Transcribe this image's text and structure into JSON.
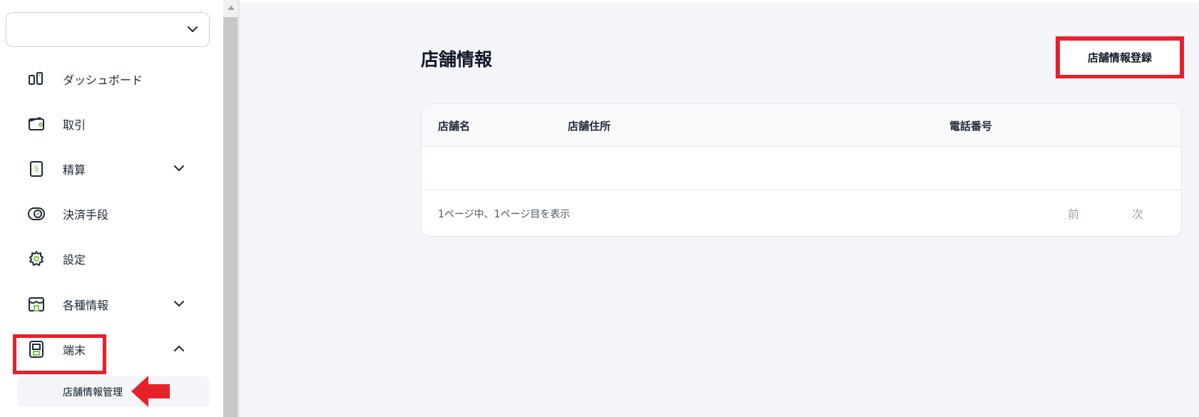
{
  "sidebar": {
    "select_value": "",
    "items": [
      {
        "label": "ダッシュボード",
        "icon": "dashboard-icon",
        "expandable": false
      },
      {
        "label": "取引",
        "icon": "wallet-icon",
        "expandable": false
      },
      {
        "label": "精算",
        "icon": "dollar-receipt-icon",
        "expandable": true,
        "expanded": false
      },
      {
        "label": "決済手段",
        "icon": "card-toggle-icon",
        "expandable": false
      },
      {
        "label": "設定",
        "icon": "gear-icon",
        "expandable": false
      },
      {
        "label": "各種情報",
        "icon": "store-icon",
        "expandable": true,
        "expanded": false
      },
      {
        "label": "端末",
        "icon": "terminal-icon",
        "expandable": true,
        "expanded": true
      }
    ],
    "sub_items": [
      {
        "label": "店舗情報管理"
      }
    ]
  },
  "main": {
    "title": "店舗情報",
    "register_button": "店舗情報登録",
    "table": {
      "columns": [
        "店舗名",
        "店舗住所",
        "電話番号"
      ],
      "rows": []
    },
    "pagination": {
      "summary": "1ページ中、1ページ目を表示",
      "prev": "前",
      "next": "次"
    }
  },
  "colors": {
    "accent_green": "#7ac943",
    "highlight_red": "#e8202a",
    "background": "#f3f5f8"
  }
}
